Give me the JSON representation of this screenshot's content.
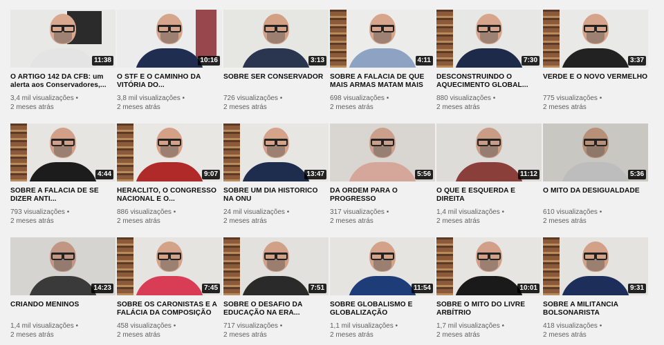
{
  "videos": [
    {
      "title": "O ARTIGO 142 DA CFB: um alerta aos Conservadores,...",
      "duration": "11:38",
      "views": "3,4 mil visualizações",
      "age": "2 meses atrás",
      "bg": "#e8e8e6",
      "skin": "#d9a88f",
      "shirt": "#e4e4e4",
      "scene": "screen"
    },
    {
      "title": "O STF E O CAMINHO DA VITÓRIA DO...",
      "duration": "10:16",
      "views": "3,8 mil visualizações",
      "age": "2 meses atrás",
      "bg": "#ececec",
      "skin": "#d5a58c",
      "shirt": "#1f2e50",
      "scene": "door"
    },
    {
      "title": "SOBRE SER CONSERVADOR",
      "duration": "3:13",
      "views": "726 visualizações",
      "age": "2 meses atrás",
      "bg": "#e6e6e3",
      "skin": "#d3a086",
      "shirt": "#2a3550",
      "scene": "plain"
    },
    {
      "title": "SOBRE A FALÁCIA DE QUE MAIS ARMAS MATAM MAIS",
      "duration": "4:11",
      "views": "698 visualizações",
      "age": "2 meses atrás",
      "bg": "#ececea",
      "skin": "#d7a58c",
      "shirt": "#8ea2c4",
      "scene": "shelf"
    },
    {
      "title": "DESCONSTRUINDO O AQUECIMENTO GLOBAL...",
      "duration": "7:30",
      "views": "880 visualizações",
      "age": "2 meses atrás",
      "bg": "#e7e7e6",
      "skin": "#d7a58c",
      "shirt": "#1e2a4a",
      "scene": "shelf"
    },
    {
      "title": "VERDE E O NOVO VERMELHO",
      "duration": "3:37",
      "views": "775 visualizações",
      "age": "2 meses atrás",
      "bg": "#e9e9e8",
      "skin": "#d6a48b",
      "shirt": "#222222",
      "scene": "shelf"
    },
    {
      "title": "SOBRE A FALÁCIA DE SE DIZER ANTI...",
      "duration": "4:44",
      "views": "793 visualizações",
      "age": "2 meses atrás",
      "bg": "#e6e5e2",
      "skin": "#d2a088",
      "shirt": "#1c1c1c",
      "scene": "shelf"
    },
    {
      "title": "HERÁCLITO, O CONGRESSO NACIONAL E O...",
      "duration": "9:07",
      "views": "886 visualizações",
      "age": "2 meses atrás",
      "bg": "#e8e7e4",
      "skin": "#d4a187",
      "shirt": "#b02a2a",
      "scene": "shelf"
    },
    {
      "title": "SOBRE UM DIA HISTÓRICO NA ONU",
      "duration": "13:47",
      "views": "24 mil visualizações",
      "age": "2 meses atrás",
      "bg": "#e7e6e3",
      "skin": "#d5a28a",
      "shirt": "#1e2c4e",
      "scene": "shelf"
    },
    {
      "title": "DA ORDEM PARA O PROGRESSO",
      "duration": "5:56",
      "views": "317 visualizações",
      "age": "2 meses atrás",
      "bg": "#d9d6d1",
      "skin": "#caa08c",
      "shirt": "#d4a79a",
      "scene": "plain"
    },
    {
      "title": "O QUE É ESQUERDA E DIREITA",
      "duration": "11:12",
      "views": "1,4 mil visualizações",
      "age": "2 meses atrás",
      "bg": "#dedcd8",
      "skin": "#c99c86",
      "shirt": "#8b3f3a",
      "scene": "plain"
    },
    {
      "title": "O MITO DA DESIGUALDADE",
      "duration": "5:36",
      "views": "610 visualizações",
      "age": "2 meses atrás",
      "bg": "#c9c7c2",
      "skin": "#b89078",
      "shirt": "#bdbdbd",
      "scene": "plain"
    },
    {
      "title": "CRIANDO MENINOS",
      "duration": "14:23",
      "views": "1,4 mil visualizações",
      "age": "2 meses atrás",
      "bg": "#d6d4d0",
      "skin": "#c19784",
      "shirt": "#3a3a3a",
      "scene": "plain"
    },
    {
      "title": "SOBRE OS CARONISTAS E A FALÁCIA DA COMPOSIÇÃO",
      "duration": "7:45",
      "views": "458 visualizações",
      "age": "2 meses atrás",
      "bg": "#e5e4e1",
      "skin": "#d4a289",
      "shirt": "#d83d55",
      "scene": "shelf"
    },
    {
      "title": "SOBRE O DESAFIO DA EDUCAÇÃO NA ERA...",
      "duration": "7:51",
      "views": "717 visualizações",
      "age": "2 meses atrás",
      "bg": "#e2e1dd",
      "skin": "#d1a087",
      "shirt": "#2a2a2a",
      "scene": "shelf"
    },
    {
      "title": "SOBRE GLOBALISMO E GLOBALIZAÇÃO",
      "duration": "11:54",
      "views": "1,1 mil visualizações",
      "age": "2 meses atrás",
      "bg": "#e5e4e1",
      "skin": "#d3a288",
      "shirt": "#1e3c78",
      "scene": "plain"
    },
    {
      "title": "SOBRE O MITO DO LIVRE ARBÍTRIO",
      "duration": "10:01",
      "views": "1,7 mil visualizações",
      "age": "2 meses atrás",
      "bg": "#e6e5e2",
      "skin": "#d2a088",
      "shirt": "#1a1a1a",
      "scene": "shelf"
    },
    {
      "title": "SOBRE A MILITÂNCIA BOLSONARISTA",
      "duration": "9:31",
      "views": "418 visualizações",
      "age": "2 meses atrás",
      "bg": "#e4e3e0",
      "skin": "#d2a188",
      "shirt": "#1e2e5a",
      "scene": "shelf"
    }
  ]
}
